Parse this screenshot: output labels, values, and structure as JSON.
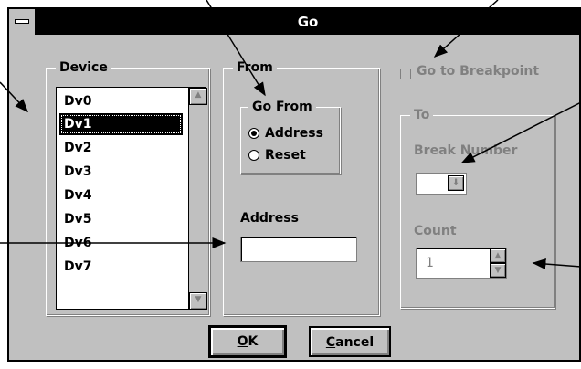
{
  "window": {
    "title": "Go"
  },
  "device": {
    "label": "Device",
    "items": [
      "Dv0",
      "Dv1",
      "Dv2",
      "Dv3",
      "Dv4",
      "Dv5",
      "Dv6",
      "Dv7"
    ],
    "selected": "Dv1"
  },
  "from": {
    "label": "From",
    "go_from_label": "Go From",
    "options": [
      {
        "label": "Address",
        "checked": true
      },
      {
        "label": "Reset",
        "checked": false
      }
    ],
    "address_label": "Address",
    "address_value": ""
  },
  "breakpoint": {
    "checkbox_label": "Go to Breakpoint",
    "checked": false,
    "to_label": "To",
    "break_number_label": "Break Number",
    "count_label": "Count",
    "count_value": "1"
  },
  "buttons": {
    "ok_mnemonic": "O",
    "ok_rest": "K",
    "cancel_mnemonic": "C",
    "cancel_rest": "ancel"
  },
  "colors": {
    "face": "#c0c0c0",
    "titlebar": "#000000",
    "disabled": "#808080",
    "selection": "#000000"
  }
}
